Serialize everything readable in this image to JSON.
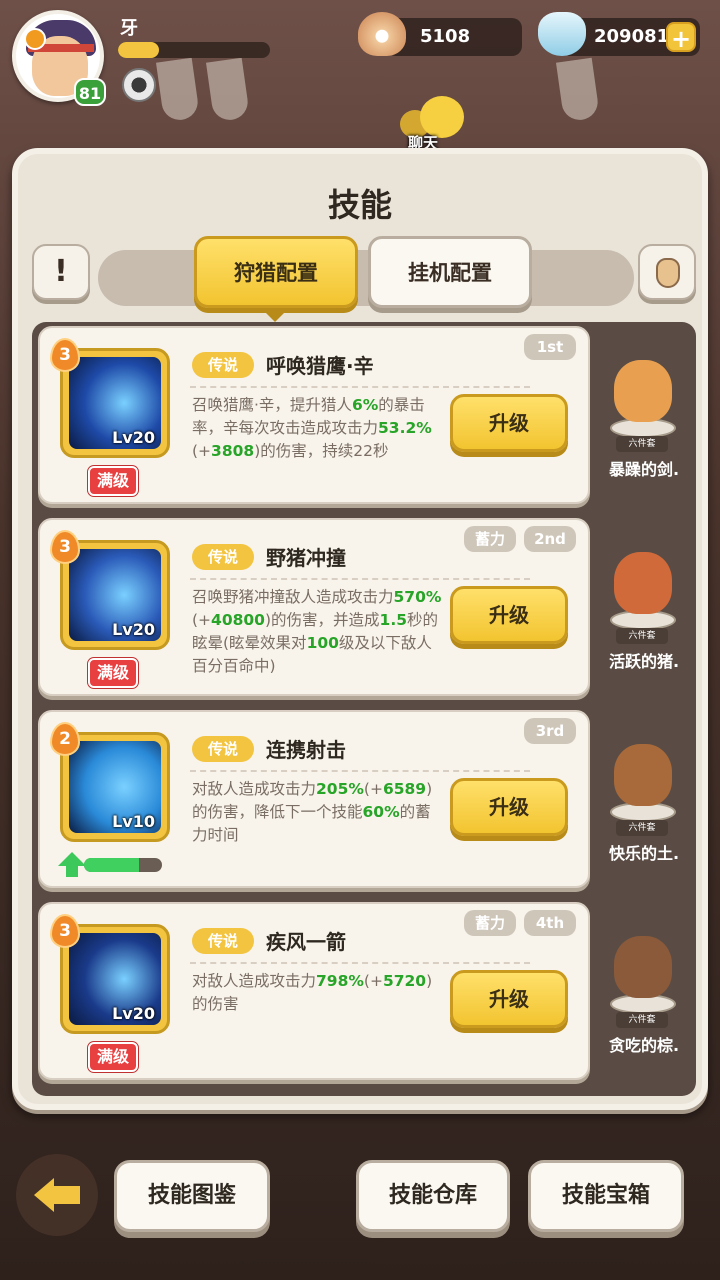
{
  "player": {
    "name": "牙",
    "level": "81",
    "exp_fraction": 0.27
  },
  "resources": {
    "pearl": "5108",
    "gem": "209081",
    "add_label": "+"
  },
  "chat": {
    "label": "聊天"
  },
  "panel": {
    "title": "技能",
    "info_label": "!",
    "tabs": [
      {
        "label": "狩猎配置",
        "active": true
      },
      {
        "label": "挂机配置",
        "active": false
      }
    ]
  },
  "skills": [
    {
      "stars": "3",
      "level": "Lv20",
      "max_label": "满级",
      "rarity": "传说",
      "name": "呼唤猎鹰·辛",
      "rank": "1st",
      "charge": "",
      "desc": [
        "召唤猎鹰·辛，提升猎人",
        {
          "g": "6%"
        },
        "的暴击率，辛每次攻击造成攻击力",
        {
          "g": "53.2%"
        },
        "(+",
        {
          "g": "3808"
        },
        ")的伤害，持续22秒"
      ],
      "upgrade": "升级",
      "pet_name": "暴躁的剑.",
      "pet_set": "六件套",
      "pet_color": "#e8a050",
      "icon_bg": "#1e4aa8"
    },
    {
      "stars": "3",
      "level": "Lv20",
      "max_label": "满级",
      "rarity": "传说",
      "name": "野猪冲撞",
      "rank": "2nd",
      "charge": "蓄力",
      "desc": [
        "召唤野猪冲撞敌人造成攻击力",
        {
          "g": "570%"
        },
        "(+",
        {
          "g": "40800"
        },
        ")的伤害，并造成",
        {
          "g": "1.5"
        },
        "秒的眩晕(眩晕效果对",
        {
          "g": "100"
        },
        "级及以下敌人百分百命中)"
      ],
      "upgrade": "升级",
      "pet_name": "活跃的猪.",
      "pet_set": "六件套",
      "pet_color": "#d06a3a",
      "icon_bg": "#2a5ab8"
    },
    {
      "stars": "2",
      "level": "Lv10",
      "max_label": "",
      "rarity": "传说",
      "name": "连携射击",
      "rank": "3rd",
      "charge": "",
      "desc": [
        "对敌人造成攻击力",
        {
          "g": "205%"
        },
        "(+",
        {
          "g": "6589"
        },
        ")的伤害，降低下一个技能",
        {
          "g": "60%"
        },
        "的蓄力时间"
      ],
      "upgrade": "升级",
      "pet_name": "快乐的土.",
      "pet_set": "六件套",
      "pet_color": "#a86a3a",
      "icon_bg": "#2a8ad8",
      "progress": 0.7
    },
    {
      "stars": "3",
      "level": "Lv20",
      "max_label": "满级",
      "rarity": "传说",
      "name": "疾风一箭",
      "rank": "4th",
      "charge": "蓄力",
      "desc": [
        "对敌人造成攻击力",
        {
          "g": "798%"
        },
        "(+",
        {
          "g": "5720"
        },
        ")的伤害"
      ],
      "upgrade": "升级",
      "pet_name": "贪吃的棕.",
      "pet_set": "六件套",
      "pet_color": "#8a5a3a",
      "icon_bg": "#1a3a8a"
    }
  ],
  "bottom": {
    "codex": "技能图鉴",
    "storage": "技能仓库",
    "chest": "技能宝箱"
  },
  "colors": {
    "accent": "#f2c440",
    "highlight": "#28a428",
    "max_badge": "#e84040"
  }
}
